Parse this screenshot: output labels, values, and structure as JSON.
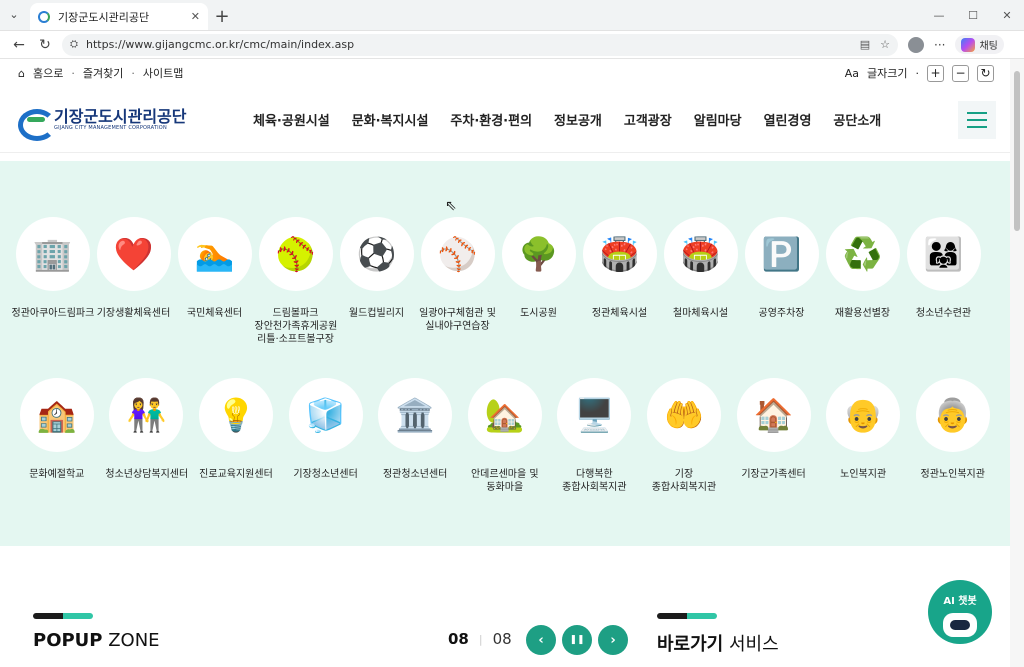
{
  "browser": {
    "tab_title": "기장군도시관리공단",
    "url": "https://www.gijangcmc.or.kr/cmc/main/index.asp",
    "copilot_label": "채팅",
    "new_tab": "+",
    "win_min": "—",
    "win_max": "☐",
    "win_close": "✕"
  },
  "util": {
    "home": "홈으로",
    "favorites": "즐겨찾기",
    "sitemap": "사이트맵",
    "font_size": "글자크기",
    "plus": "+",
    "minus": "−",
    "reset": "↻"
  },
  "header": {
    "logo_name": "기장군도시관리공단",
    "logo_sub": "GIJANG CITY MANAGEMENT CORPORATION",
    "nav": [
      "체육·공원시설",
      "문화·복지시설",
      "주차·환경·편의",
      "정보공개",
      "고객광장",
      "알림마당",
      "열린경영",
      "공단소개"
    ]
  },
  "facilities_row1": [
    {
      "label": "정관아쿠아드림파크",
      "icon": "🏢"
    },
    {
      "label": "기장생활체육센터",
      "icon": "❤️"
    },
    {
      "label": "국민체육센터",
      "icon": "🏊"
    },
    {
      "label": "드림볼파크 장안천가족휴게공원 리틀·소프트볼구장",
      "icon": "🥎"
    },
    {
      "label": "월드컵빌리지",
      "icon": "⚽"
    },
    {
      "label": "일광야구체험관 및 실내야구연습장",
      "icon": "⚾"
    },
    {
      "label": "도시공원",
      "icon": "🌳"
    },
    {
      "label": "정관체육시설",
      "icon": "🏟️"
    },
    {
      "label": "철마체육시설",
      "icon": "🏟️"
    },
    {
      "label": "공영주차장",
      "icon": "🅿️"
    },
    {
      "label": "재활용선별장",
      "icon": "♻️"
    },
    {
      "label": "청소년수련관",
      "icon": "👨‍👩‍👧"
    }
  ],
  "facilities_row2": [
    {
      "label": "문화예절학교",
      "icon": "🏫"
    },
    {
      "label": "청소년상담복지센터",
      "icon": "👫"
    },
    {
      "label": "진로교육지원센터",
      "icon": "💡"
    },
    {
      "label": "기장청소년센터",
      "icon": "🧊"
    },
    {
      "label": "정관청소년센터",
      "icon": "🏛️"
    },
    {
      "label": "안데르센마을 및 동화마을",
      "icon": "🏡"
    },
    {
      "label": "다행복한 종합사회복지관",
      "icon": "🖥️"
    },
    {
      "label": "기장 종합사회복지관",
      "icon": "🤲"
    },
    {
      "label": "기장군가족센터",
      "icon": "🏠"
    },
    {
      "label": "노인복지관",
      "icon": "👴"
    },
    {
      "label": "정관노인복지관",
      "icon": "👵"
    }
  ],
  "popup": {
    "title_bold": "POPUP",
    "title_rest": " ZONE",
    "current": "08",
    "total": "08",
    "prev": "‹",
    "pause": "❚❚",
    "next": "›"
  },
  "shortcut": {
    "title_bold": "바로가기",
    "title_rest": " 서비스"
  },
  "chatbot": {
    "label": "AI 챗봇"
  },
  "colors": {
    "accent": "#1e9f84",
    "facility_bg": "#e4f7f1",
    "logo_blue": "#16377a"
  }
}
